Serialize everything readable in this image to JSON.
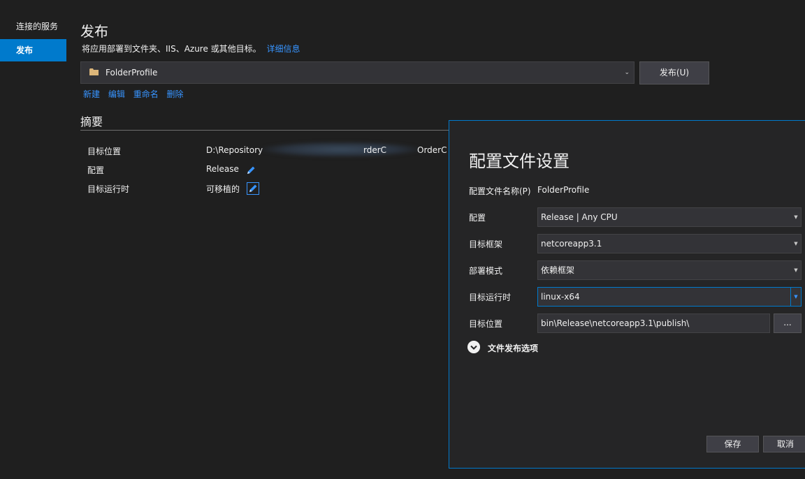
{
  "sidebar": {
    "items": [
      {
        "label": "连接的服务"
      },
      {
        "label": "发布"
      }
    ]
  },
  "header": {
    "title": "发布",
    "subtitle": "将应用部署到文件夹、IIS、Azure 或其他目标。",
    "details_link": "详细信息"
  },
  "profile": {
    "selected": "FolderProfile",
    "publish_label": "发布(U)",
    "actions": [
      "新建",
      "编辑",
      "重命名",
      "删除"
    ]
  },
  "summary": {
    "title": "摘要",
    "rows": [
      {
        "label": "目标位置",
        "value_start": "D:\\Repository",
        "value_mid": "rderC",
        "value_end": "OrderC"
      },
      {
        "label": "配置",
        "value": "Release"
      },
      {
        "label": "目标运行时",
        "value": "可移植的"
      }
    ]
  },
  "dialog": {
    "title": "配置文件设置",
    "profile_name_label": "配置文件名称(P)",
    "profile_name_value": "FolderProfile",
    "configuration_label": "配置",
    "configuration_value": "Release | Any CPU",
    "framework_label": "目标框架",
    "framework_value": "netcoreapp3.1",
    "deploy_mode_label": "部署模式",
    "deploy_mode_value": "依赖框架",
    "runtime_label": "目标运行时",
    "runtime_value": "linux-x64",
    "location_label": "目标位置",
    "location_value": "bin\\Release\\netcoreapp3.1\\publish\\",
    "browse_label": "...",
    "file_options_label": "文件发布选项",
    "save_label": "保存",
    "cancel_label": "取消"
  },
  "colors": {
    "accent": "#007acc",
    "link": "#3794ff",
    "background": "#1f1f1f",
    "panel": "#252526"
  }
}
